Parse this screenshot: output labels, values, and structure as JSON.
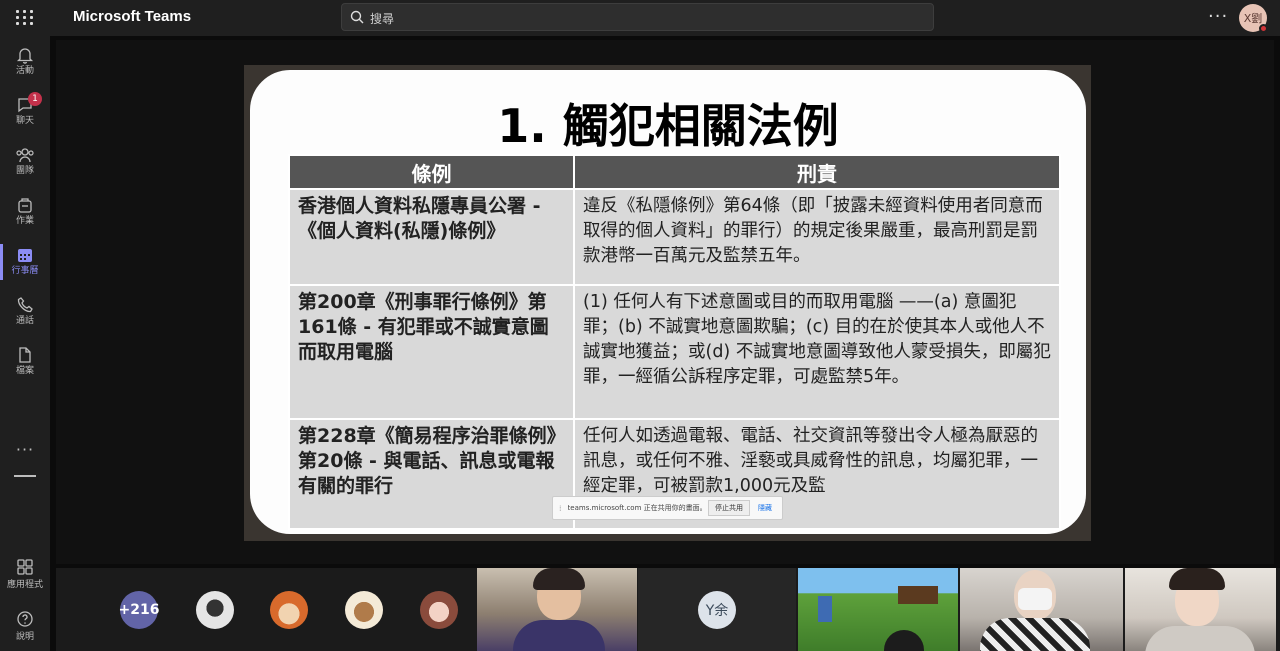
{
  "app": {
    "title": "Microsoft Teams",
    "search_placeholder": "搜尋",
    "more_label": "···",
    "user_initials": "X劉"
  },
  "rail": {
    "items": [
      {
        "label": "活動",
        "icon": "bell-icon"
      },
      {
        "label": "聊天",
        "icon": "chat-icon",
        "badge": "1"
      },
      {
        "label": "團隊",
        "icon": "teams-icon"
      },
      {
        "label": "作業",
        "icon": "assignments-icon"
      },
      {
        "label": "行事曆",
        "icon": "calendar-icon",
        "active": true
      },
      {
        "label": "通話",
        "icon": "phone-icon"
      },
      {
        "label": "檔案",
        "icon": "file-icon"
      }
    ],
    "more_dots": "···",
    "apps_label": "應用程式",
    "help_label": "說明"
  },
  "slide": {
    "title": "1. 觸犯相關法例",
    "headers": [
      "條例",
      "刑責"
    ],
    "rows": [
      {
        "law": "香港個人資料私隱專員公署 - 《個人資料(私隱)條例》",
        "penalty": "違反《私隱條例》第64條（即「披露未經資料使用者同意而取得的個人資料」的罪行）的規定後果嚴重，最高刑罰是罰款港幣一百萬元及監禁五年。"
      },
      {
        "law": "第200章《刑事罪行條例》第161條 - 有犯罪或不誠實意圖而取用電腦",
        "penalty": "(1) 任何人有下述意圖或目的而取用電腦 ——(a) 意圖犯罪；(b) 不誠實地意圖欺騙；(c) 目的在於使其本人或他人不誠實地獲益；或(d) 不誠實地意圖導致他人蒙受損失，即屬犯罪，一經循公訴程序定罪，可處監禁5年。"
      },
      {
        "law": "第228章《簡易程序治罪條例》第20條 - 與電話、訊息或電報有關的罪行",
        "penalty": "任何人如透過電報、電話、社交資訊等發出令人極為厭惡的訊息，或任何不雅、淫褻或具威脅性的訊息，均屬犯罪，一經定罪，可被罰款1,000元及監"
      }
    ]
  },
  "share_toast": {
    "message": "teams.microsoft.com 正在共用你的畫面。",
    "stop_label": "停止共用",
    "hide_label": "隱藏"
  },
  "participants": {
    "overflow": "+216",
    "y_initials": "Y余"
  }
}
